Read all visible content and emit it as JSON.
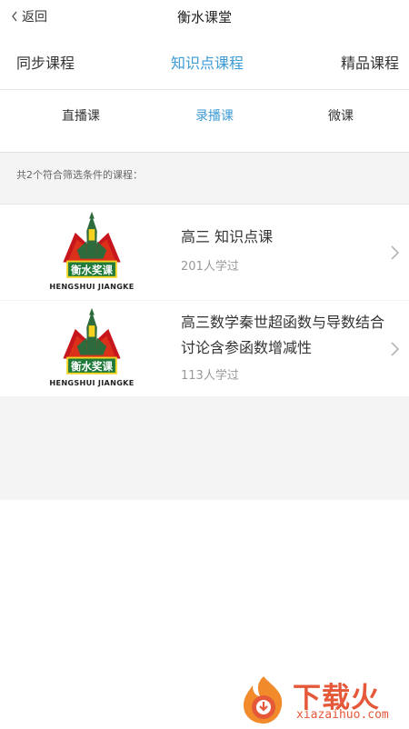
{
  "header": {
    "back_label": "返回",
    "title": "衡水课堂"
  },
  "tabs": [
    {
      "label": "同步课程",
      "active": false
    },
    {
      "label": "知识点课程",
      "active": true
    },
    {
      "label": "精品课程",
      "active": false
    }
  ],
  "subtabs": [
    {
      "label": "直播课",
      "active": false
    },
    {
      "label": "录播课",
      "active": true
    },
    {
      "label": "微课",
      "active": false
    }
  ],
  "filter_summary": "共2个符合筛选条件的课程：",
  "courses": [
    {
      "title_lines": [
        "高三 知识点课"
      ],
      "learners": "201人学过",
      "logo": {
        "banner_text": "衡水奖课",
        "caption": "HENGSHUI JIANGKE",
        "badge": "衡水"
      }
    },
    {
      "title_lines": [
        "高三数学秦世超函数与导数结合",
        "讨论含参函数增减性"
      ],
      "learners": "113人学过",
      "logo": {
        "banner_text": "衡水奖课",
        "caption": "HENGSHUI JIANGKE",
        "badge": "衡水"
      }
    }
  ],
  "watermark": {
    "text": "下载火",
    "sub": "xiazaihuo.com"
  },
  "colors": {
    "accent": "#3d9bd6",
    "watermark": "#e5583a",
    "logo_red": "#c8161d",
    "logo_green": "#2d6b3c",
    "logo_yellow": "#f5d21f"
  }
}
